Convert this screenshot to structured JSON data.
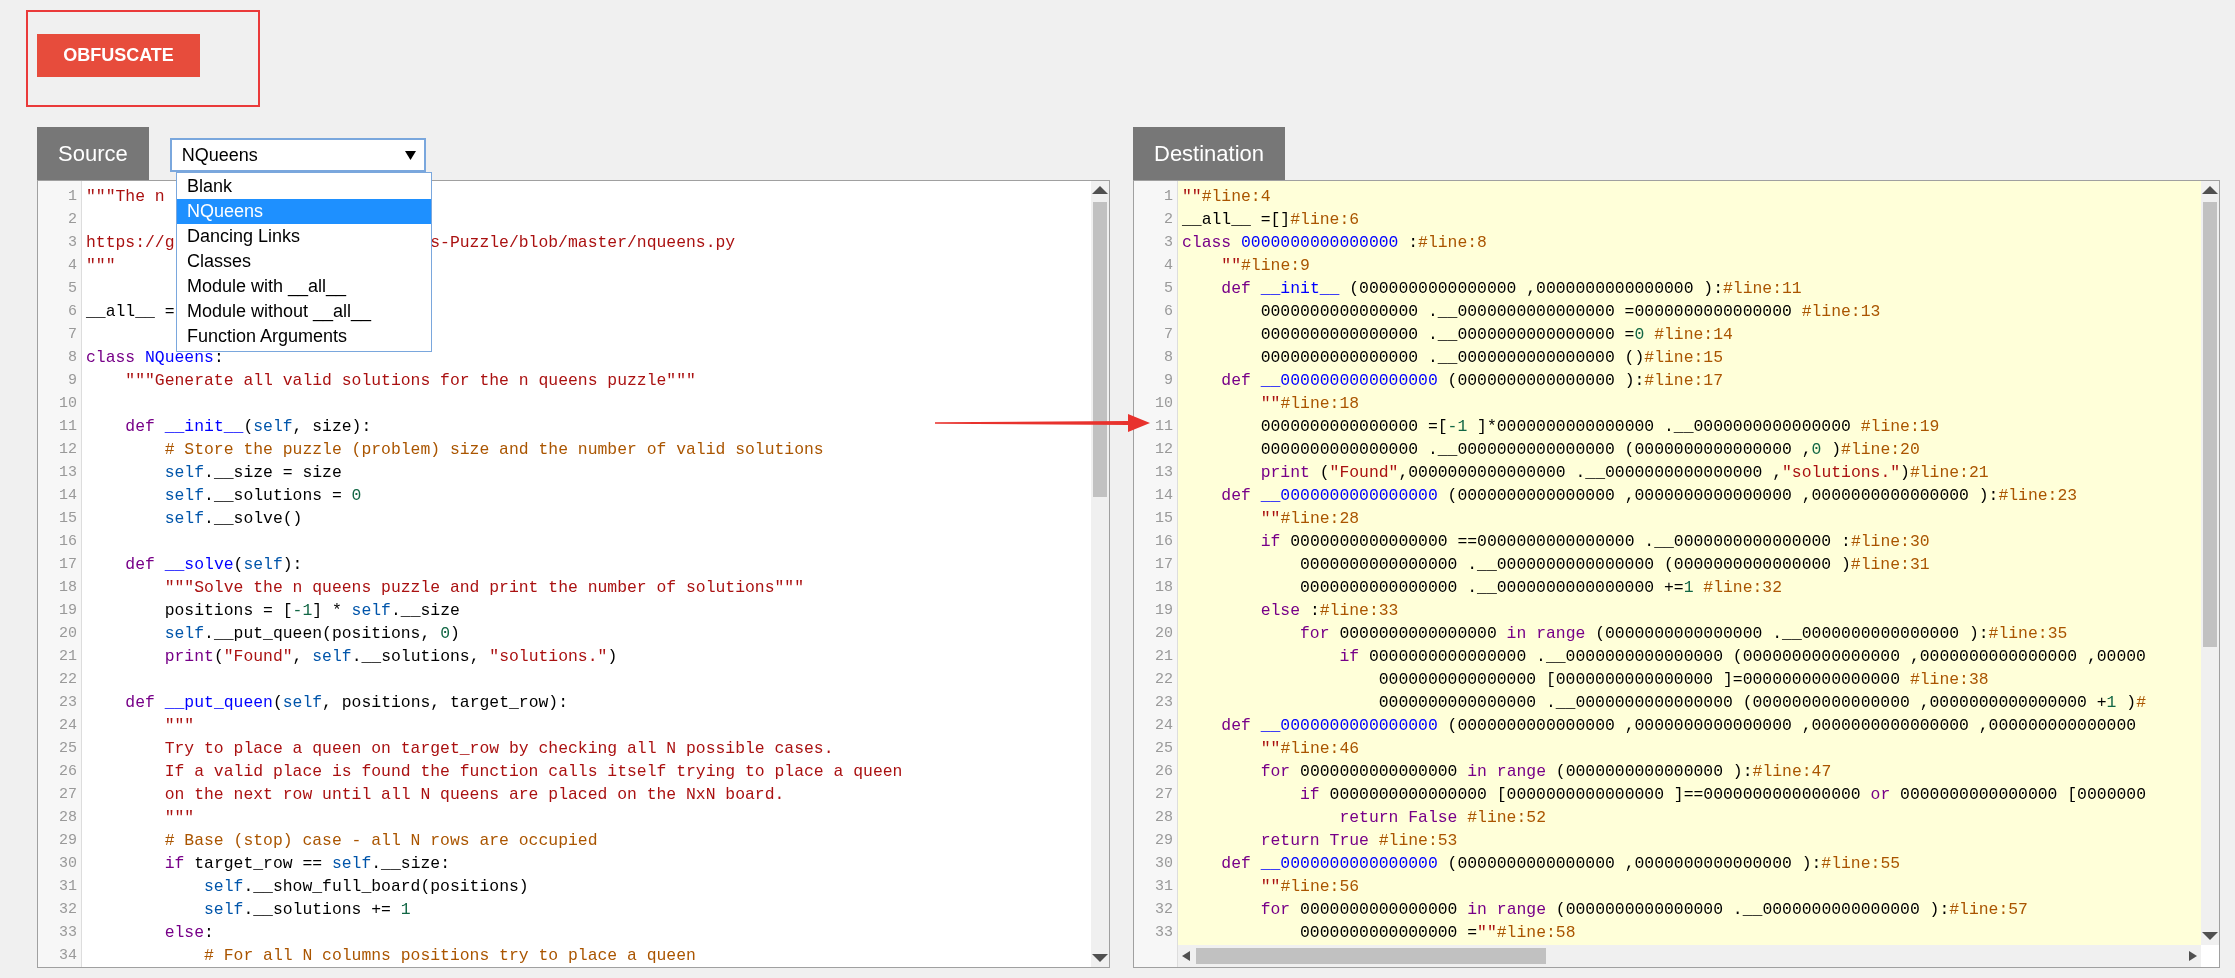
{
  "obfuscate_button": "OBFUSCATE",
  "source": {
    "tab": "Source",
    "select": {
      "value": "NQueens",
      "options": [
        {
          "label": "Blank",
          "selected": false
        },
        {
          "label": "NQueens",
          "selected": true
        },
        {
          "label": "Dancing Links",
          "selected": false
        },
        {
          "label": "Classes",
          "selected": false
        },
        {
          "label": "Module with __all__",
          "selected": false
        },
        {
          "label": "Module without __all__",
          "selected": false
        },
        {
          "label": "Function Arguments",
          "selected": false
        }
      ]
    },
    "lines": [
      {
        "number": "1",
        "tokens": [
          {
            "kind": "string",
            "text": "\"\"\"The n"
          }
        ]
      },
      {
        "number": "2"
      },
      {
        "number": "3",
        "tokens": [
          {
            "kind": "string",
            "text": "https://g"
          }
        ],
        "after_menu": [
          {
            "kind": "string",
            "text": "s-Puzzle/blob/master/nqueens.py"
          }
        ]
      },
      {
        "number": "4",
        "tokens": [
          {
            "kind": "string",
            "text": "\"\"\""
          }
        ]
      },
      {
        "number": "5"
      },
      {
        "number": "6",
        "tokens": [
          {
            "kind": "plain",
            "text": "__all__ ="
          }
        ]
      },
      {
        "number": "7"
      },
      {
        "number": "8",
        "tokens": [
          {
            "kind": "keyword",
            "text": "class"
          },
          {
            "kind": "def",
            "text": " NQueens"
          },
          {
            "kind": "plain",
            "text": ":"
          }
        ]
      },
      {
        "number": "9",
        "tokens": [
          {
            "kind": "string",
            "text": "    \"\"\"Generate all valid solutions for the n queens puzzle\"\"\""
          }
        ]
      },
      {
        "number": "10"
      },
      {
        "number": "11",
        "tokens": [
          {
            "kind": "keyword",
            "text": "    def"
          },
          {
            "kind": "def",
            "text": " __init__"
          },
          {
            "kind": "plain",
            "text": "("
          },
          {
            "kind": "variable",
            "text": "self"
          },
          {
            "kind": "plain",
            "text": ", size):"
          }
        ]
      },
      {
        "number": "12",
        "tokens": [
          {
            "kind": "comment",
            "text": "        # Store the puzzle (problem) size and the number of valid solutions"
          }
        ]
      },
      {
        "number": "13",
        "tokens": [
          {
            "kind": "variable",
            "text": "        self"
          },
          {
            "kind": "plain",
            "text": ".__size = size"
          }
        ]
      },
      {
        "number": "14",
        "tokens": [
          {
            "kind": "variable",
            "text": "        self"
          },
          {
            "kind": "plain",
            "text": ".__solutions = "
          },
          {
            "kind": "number",
            "text": "0"
          }
        ]
      },
      {
        "number": "15",
        "tokens": [
          {
            "kind": "variable",
            "text": "        self"
          },
          {
            "kind": "plain",
            "text": ".__solve()"
          }
        ]
      },
      {
        "number": "16"
      },
      {
        "number": "17",
        "tokens": [
          {
            "kind": "keyword",
            "text": "    def"
          },
          {
            "kind": "def",
            "text": " __solve"
          },
          {
            "kind": "plain",
            "text": "("
          },
          {
            "kind": "variable",
            "text": "self"
          },
          {
            "kind": "plain",
            "text": "):"
          }
        ]
      },
      {
        "number": "18",
        "tokens": [
          {
            "kind": "string",
            "text": "        \"\"\"Solve the n queens puzzle and print the number of solutions\"\"\""
          }
        ]
      },
      {
        "number": "19",
        "tokens": [
          {
            "kind": "plain",
            "text": "        positions = ["
          },
          {
            "kind": "number",
            "text": "-1"
          },
          {
            "kind": "plain",
            "text": "] * "
          },
          {
            "kind": "variable",
            "text": "self"
          },
          {
            "kind": "plain",
            "text": ".__size"
          }
        ]
      },
      {
        "number": "20",
        "tokens": [
          {
            "kind": "variable",
            "text": "        self"
          },
          {
            "kind": "plain",
            "text": ".__put_queen(positions, "
          },
          {
            "kind": "number",
            "text": "0"
          },
          {
            "kind": "plain",
            "text": ")"
          }
        ]
      },
      {
        "number": "21",
        "tokens": [
          {
            "kind": "keyword",
            "text": "        print"
          },
          {
            "kind": "plain",
            "text": "("
          },
          {
            "kind": "string",
            "text": "\"Found\""
          },
          {
            "kind": "plain",
            "text": ", "
          },
          {
            "kind": "variable",
            "text": "self"
          },
          {
            "kind": "plain",
            "text": ".__solutions, "
          },
          {
            "kind": "string",
            "text": "\"solutions.\""
          },
          {
            "kind": "plain",
            "text": ")"
          }
        ]
      },
      {
        "number": "22"
      },
      {
        "number": "23",
        "tokens": [
          {
            "kind": "keyword",
            "text": "    def"
          },
          {
            "kind": "def",
            "text": " __put_queen"
          },
          {
            "kind": "plain",
            "text": "("
          },
          {
            "kind": "variable",
            "text": "self"
          },
          {
            "kind": "plain",
            "text": ", positions, target_row):"
          }
        ]
      },
      {
        "number": "24",
        "tokens": [
          {
            "kind": "string",
            "text": "        \"\"\""
          }
        ]
      },
      {
        "number": "25",
        "tokens": [
          {
            "kind": "string",
            "text": "        Try to place a queen on target_row by checking all N possible cases."
          }
        ]
      },
      {
        "number": "26",
        "tokens": [
          {
            "kind": "string",
            "text": "        If a valid place is found the function calls itself trying to place a queen"
          }
        ]
      },
      {
        "number": "27",
        "tokens": [
          {
            "kind": "string",
            "text": "        on the next row until all N queens are placed on the NxN board."
          }
        ]
      },
      {
        "number": "28",
        "tokens": [
          {
            "kind": "string",
            "text": "        \"\"\""
          }
        ]
      },
      {
        "number": "29",
        "tokens": [
          {
            "kind": "comment",
            "text": "        # Base (stop) case - all N rows are occupied"
          }
        ]
      },
      {
        "number": "30",
        "tokens": [
          {
            "kind": "keyword",
            "text": "        if"
          },
          {
            "kind": "plain",
            "text": " target_row == "
          },
          {
            "kind": "variable",
            "text": "self"
          },
          {
            "kind": "plain",
            "text": ".__size:"
          }
        ]
      },
      {
        "number": "31",
        "tokens": [
          {
            "kind": "variable",
            "text": "            self"
          },
          {
            "kind": "plain",
            "text": ".__show_full_board(positions)"
          }
        ]
      },
      {
        "number": "32",
        "tokens": [
          {
            "kind": "variable",
            "text": "            self"
          },
          {
            "kind": "plain",
            "text": ".__solutions += "
          },
          {
            "kind": "number",
            "text": "1"
          }
        ]
      },
      {
        "number": "33",
        "tokens": [
          {
            "kind": "keyword",
            "text": "        else"
          },
          {
            "kind": "plain",
            "text": ":"
          }
        ]
      },
      {
        "number": "34",
        "tokens": [
          {
            "kind": "comment",
            "text": "            # For all N columns positions try to place a queen"
          }
        ]
      }
    ]
  },
  "destination": {
    "tab": "Destination",
    "lines": [
      {
        "number": "1",
        "tokens": [
          {
            "kind": "string",
            "text": "\"\""
          },
          {
            "kind": "comment",
            "text": "#line:4"
          }
        ]
      },
      {
        "number": "2",
        "tokens": [
          {
            "kind": "plain",
            "text": "__all__ =[]"
          },
          {
            "kind": "comment",
            "text": "#line:6"
          }
        ]
      },
      {
        "number": "3",
        "tokens": [
          {
            "kind": "keyword",
            "text": "class"
          },
          {
            "kind": "def",
            "text": " 0000000000000000"
          },
          {
            "kind": "plain",
            "text": " :"
          },
          {
            "kind": "comment",
            "text": "#line:8"
          }
        ]
      },
      {
        "number": "4",
        "tokens": [
          {
            "kind": "string",
            "text": "    \"\""
          },
          {
            "kind": "comment",
            "text": "#line:9"
          }
        ]
      },
      {
        "number": "5",
        "tokens": [
          {
            "kind": "keyword",
            "text": "    def"
          },
          {
            "kind": "def",
            "text": " __init__"
          },
          {
            "kind": "plain",
            "text": " (0000000000000000 ,0000000000000000 ):"
          },
          {
            "kind": "comment",
            "text": "#line:11"
          }
        ]
      },
      {
        "number": "6",
        "tokens": [
          {
            "kind": "plain",
            "text": "        0000000000000000 .__0000000000000000 =0000000000000000 "
          },
          {
            "kind": "comment",
            "text": "#line:13"
          }
        ]
      },
      {
        "number": "7",
        "tokens": [
          {
            "kind": "plain",
            "text": "        0000000000000000 .__0000000000000000 ="
          },
          {
            "kind": "number",
            "text": "0"
          },
          {
            "kind": "comment",
            "text": " #line:14"
          }
        ]
      },
      {
        "number": "8",
        "tokens": [
          {
            "kind": "plain",
            "text": "        0000000000000000 .__0000000000000000 ()"
          },
          {
            "kind": "comment",
            "text": "#line:15"
          }
        ]
      },
      {
        "number": "9",
        "tokens": [
          {
            "kind": "keyword",
            "text": "    def"
          },
          {
            "kind": "def",
            "text": " __0000000000000000"
          },
          {
            "kind": "plain",
            "text": " (0000000000000000 ):"
          },
          {
            "kind": "comment",
            "text": "#line:17"
          }
        ]
      },
      {
        "number": "10",
        "tokens": [
          {
            "kind": "string",
            "text": "        \"\""
          },
          {
            "kind": "comment",
            "text": "#line:18"
          }
        ]
      },
      {
        "number": "11",
        "tokens": [
          {
            "kind": "plain",
            "text": "        0000000000000000 =["
          },
          {
            "kind": "number",
            "text": "-1"
          },
          {
            "kind": "plain",
            "text": " ]*0000000000000000 .__0000000000000000 "
          },
          {
            "kind": "comment",
            "text": "#line:19"
          }
        ]
      },
      {
        "number": "12",
        "tokens": [
          {
            "kind": "plain",
            "text": "        0000000000000000 .__0000000000000000 (0000000000000000 ,"
          },
          {
            "kind": "number",
            "text": "0"
          },
          {
            "kind": "plain",
            "text": " )"
          },
          {
            "kind": "comment",
            "text": "#line:20"
          }
        ]
      },
      {
        "number": "13",
        "tokens": [
          {
            "kind": "keyword",
            "text": "        print"
          },
          {
            "kind": "plain",
            "text": " ("
          },
          {
            "kind": "string",
            "text": "\"Found\""
          },
          {
            "kind": "plain",
            "text": ",0000000000000000 .__0000000000000000 ,"
          },
          {
            "kind": "string",
            "text": "\"solutions.\""
          },
          {
            "kind": "plain",
            "text": ")"
          },
          {
            "kind": "comment",
            "text": "#line:21"
          }
        ]
      },
      {
        "number": "14",
        "tokens": [
          {
            "kind": "keyword",
            "text": "    def"
          },
          {
            "kind": "def",
            "text": " __0000000000000000"
          },
          {
            "kind": "plain",
            "text": " (0000000000000000 ,0000000000000000 ,0000000000000000 ):"
          },
          {
            "kind": "comment",
            "text": "#line:23"
          }
        ]
      },
      {
        "number": "15",
        "tokens": [
          {
            "kind": "string",
            "text": "        \"\""
          },
          {
            "kind": "comment",
            "text": "#line:28"
          }
        ]
      },
      {
        "number": "16",
        "tokens": [
          {
            "kind": "keyword",
            "text": "        if"
          },
          {
            "kind": "plain",
            "text": " 0000000000000000 ==0000000000000000 .__0000000000000000 :"
          },
          {
            "kind": "comment",
            "text": "#line:30"
          }
        ]
      },
      {
        "number": "17",
        "tokens": [
          {
            "kind": "plain",
            "text": "            0000000000000000 .__0000000000000000 (0000000000000000 )"
          },
          {
            "kind": "comment",
            "text": "#line:31"
          }
        ]
      },
      {
        "number": "18",
        "tokens": [
          {
            "kind": "plain",
            "text": "            0000000000000000 .__0000000000000000 +="
          },
          {
            "kind": "number",
            "text": "1"
          },
          {
            "kind": "comment",
            "text": " #line:32"
          }
        ]
      },
      {
        "number": "19",
        "tokens": [
          {
            "kind": "keyword",
            "text": "        else"
          },
          {
            "kind": "plain",
            "text": " :"
          },
          {
            "kind": "comment",
            "text": "#line:33"
          }
        ]
      },
      {
        "number": "20",
        "tokens": [
          {
            "kind": "keyword",
            "text": "            for"
          },
          {
            "kind": "plain",
            "text": " 0000000000000000 "
          },
          {
            "kind": "keyword",
            "text": "in"
          },
          {
            "kind": "keyword",
            "text": " range"
          },
          {
            "kind": "plain",
            "text": " (0000000000000000 .__0000000000000000 ):"
          },
          {
            "kind": "comment",
            "text": "#line:35"
          }
        ]
      },
      {
        "number": "21",
        "tokens": [
          {
            "kind": "keyword",
            "text": "                if"
          },
          {
            "kind": "plain",
            "text": " 0000000000000000 .__0000000000000000 (0000000000000000 ,0000000000000000 ,00000"
          }
        ]
      },
      {
        "number": "22",
        "tokens": [
          {
            "kind": "plain",
            "text": "                    0000000000000000 [0000000000000000 ]=0000000000000000 "
          },
          {
            "kind": "comment",
            "text": "#line:38"
          }
        ]
      },
      {
        "number": "23",
        "tokens": [
          {
            "kind": "plain",
            "text": "                    0000000000000000 .__0000000000000000 (0000000000000000 ,0000000000000000 +"
          },
          {
            "kind": "number",
            "text": "1"
          },
          {
            "kind": "plain",
            "text": " )"
          },
          {
            "kind": "comment",
            "text": "#"
          }
        ]
      },
      {
        "number": "24",
        "tokens": [
          {
            "kind": "keyword",
            "text": "    def"
          },
          {
            "kind": "def",
            "text": " __0000000000000000"
          },
          {
            "kind": "plain",
            "text": " (0000000000000000 ,0000000000000000 ,0000000000000000 ,000000000000000"
          }
        ]
      },
      {
        "number": "25",
        "tokens": [
          {
            "kind": "string",
            "text": "        \"\""
          },
          {
            "kind": "comment",
            "text": "#line:46"
          }
        ]
      },
      {
        "number": "26",
        "tokens": [
          {
            "kind": "keyword",
            "text": "        for"
          },
          {
            "kind": "plain",
            "text": " 0000000000000000 "
          },
          {
            "kind": "keyword",
            "text": "in"
          },
          {
            "kind": "keyword",
            "text": " range"
          },
          {
            "kind": "plain",
            "text": " (0000000000000000 ):"
          },
          {
            "kind": "comment",
            "text": "#line:47"
          }
        ]
      },
      {
        "number": "27",
        "tokens": [
          {
            "kind": "keyword",
            "text": "            if"
          },
          {
            "kind": "plain",
            "text": " 0000000000000000 [0000000000000000 ]==0000000000000000 "
          },
          {
            "kind": "keyword",
            "text": "or"
          },
          {
            "kind": "plain",
            "text": " 0000000000000000 [0000000"
          }
        ]
      },
      {
        "number": "28",
        "tokens": [
          {
            "kind": "keyword",
            "text": "                return"
          },
          {
            "kind": "keyword",
            "text": " False"
          },
          {
            "kind": "comment",
            "text": " #line:52"
          }
        ]
      },
      {
        "number": "29",
        "tokens": [
          {
            "kind": "keyword",
            "text": "        return"
          },
          {
            "kind": "keyword",
            "text": " True"
          },
          {
            "kind": "comment",
            "text": " #line:53"
          }
        ]
      },
      {
        "number": "30",
        "tokens": [
          {
            "kind": "keyword",
            "text": "    def"
          },
          {
            "kind": "def",
            "text": " __0000000000000000"
          },
          {
            "kind": "plain",
            "text": " (0000000000000000 ,0000000000000000 ):"
          },
          {
            "kind": "comment",
            "text": "#line:55"
          }
        ]
      },
      {
        "number": "31",
        "tokens": [
          {
            "kind": "string",
            "text": "        \"\""
          },
          {
            "kind": "comment",
            "text": "#line:56"
          }
        ]
      },
      {
        "number": "32",
        "tokens": [
          {
            "kind": "keyword",
            "text": "        for"
          },
          {
            "kind": "plain",
            "text": " 0000000000000000 "
          },
          {
            "kind": "keyword",
            "text": "in"
          },
          {
            "kind": "keyword",
            "text": " range"
          },
          {
            "kind": "plain",
            "text": " (0000000000000000 .__0000000000000000 ):"
          },
          {
            "kind": "comment",
            "text": "#line:57"
          }
        ]
      },
      {
        "number": "33",
        "tokens": [
          {
            "kind": "plain",
            "text": "            0000000000000000 ="
          },
          {
            "kind": "string",
            "text": "\"\""
          },
          {
            "kind": "comment",
            "text": "#line:58"
          }
        ]
      }
    ]
  }
}
